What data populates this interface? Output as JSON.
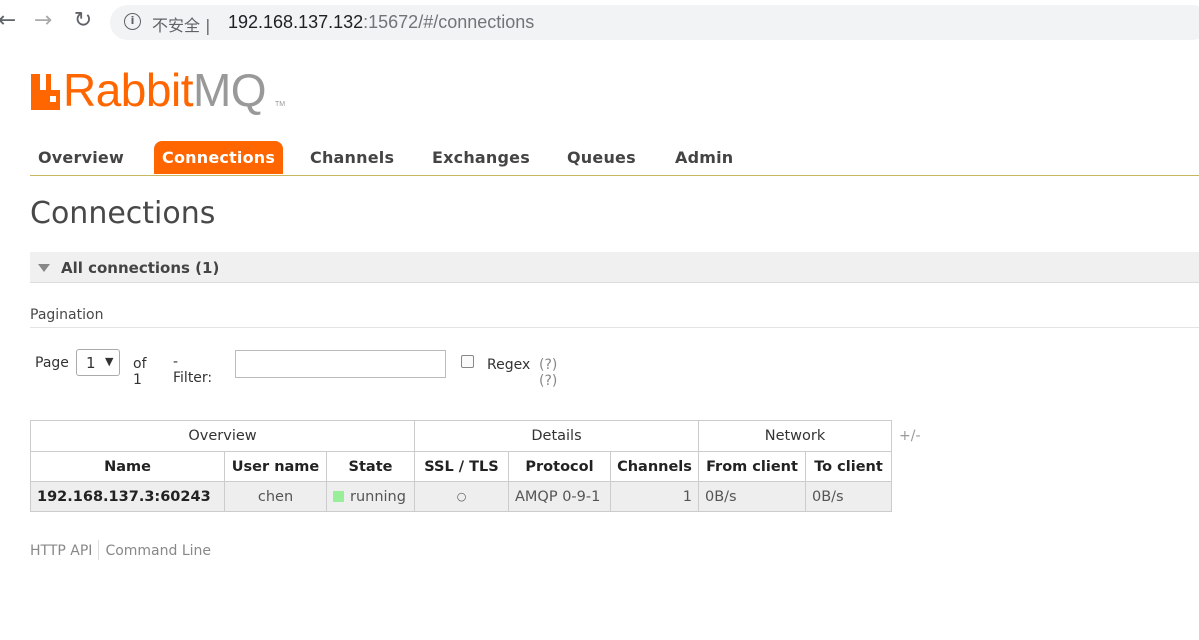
{
  "browser": {
    "back_icon": "←",
    "forward_icon": "→",
    "reload_icon": "↻",
    "info_icon": "i",
    "security_text": "不安全 |",
    "url_host": "192.168.137.132",
    "url_rest": ":15672/#/connections"
  },
  "logo": {
    "rabbit": "Rabbit",
    "mq": "MQ",
    "tm": "TM"
  },
  "tabs": [
    {
      "label": "Overview",
      "active": false
    },
    {
      "label": "Connections",
      "active": true
    },
    {
      "label": "Channels",
      "active": false
    },
    {
      "label": "Exchanges",
      "active": false
    },
    {
      "label": "Queues",
      "active": false
    },
    {
      "label": "Admin",
      "active": false
    }
  ],
  "page_title": "Connections",
  "section": {
    "title": "All connections (1)"
  },
  "pagination": {
    "label": "Pagination",
    "page_label": "Page",
    "page_value": "1",
    "of_label": "of 1",
    "filter_label": "- Filter:",
    "filter_value": "",
    "regex_label": "Regex",
    "regex_hint": "(?)(?)"
  },
  "table": {
    "groups": [
      "Overview",
      "Details",
      "Network"
    ],
    "columns": [
      "Name",
      "User name",
      "State",
      "SSL / TLS",
      "Protocol",
      "Channels",
      "From client",
      "To client"
    ],
    "rows": [
      {
        "name": "192.168.137.3:60243",
        "user": "chen",
        "state": "running",
        "ssl": "○",
        "protocol": "AMQP 0-9-1",
        "channels": "1",
        "from_client": "0B/s",
        "to_client": "0B/s"
      }
    ],
    "toggle_columns": "+/-"
  },
  "footer": {
    "http_api": "HTTP API",
    "command_line": "Command Line"
  },
  "colors": {
    "brand": "#ff6600",
    "running": "#99ee99"
  }
}
